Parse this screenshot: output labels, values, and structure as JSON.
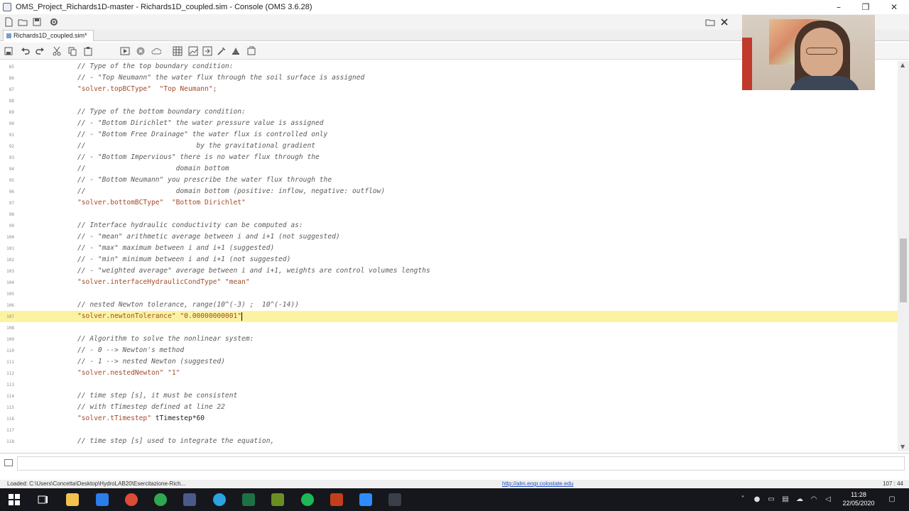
{
  "window": {
    "title": "OMS_Project_Richards1D-master - Richards1D_coupled.sim - Console (OMS 3.6.28)",
    "minimize_glyph": "–",
    "restore_glyph": "❐",
    "close_glyph": "✕"
  },
  "tab": {
    "label": "Richards1D_coupled.sim*"
  },
  "editor": {
    "lines": [
      {
        "n": "85",
        "kind": "cm",
        "text": "// Type of the top boundary condition:"
      },
      {
        "n": "86",
        "kind": "cm",
        "text": "// - \"Top Neumann\" the water flux through the soil surface is assigned"
      },
      {
        "n": "87",
        "kind": "str",
        "text": "\"solver.topBCType\"  \"Top Neumann\";"
      },
      {
        "n": "88",
        "kind": "plain",
        "text": ""
      },
      {
        "n": "89",
        "kind": "cm",
        "text": "// Type of the bottom boundary condition:"
      },
      {
        "n": "90",
        "kind": "cm",
        "text": "// - \"Bottom Dirichlet\" the water pressure value is assigned"
      },
      {
        "n": "91",
        "kind": "cm",
        "text": "// - \"Bottom Free Drainage\" the water flux is controlled only"
      },
      {
        "n": "92",
        "kind": "cm",
        "text": "//                           by the gravitational gradient"
      },
      {
        "n": "93",
        "kind": "cm",
        "text": "// - \"Bottom Impervious\" there is no water flux through the"
      },
      {
        "n": "94",
        "kind": "cm",
        "text": "//                      domain bottom"
      },
      {
        "n": "95",
        "kind": "cm",
        "text": "// - \"Bottom Neumann\" you prescribe the water flux through the"
      },
      {
        "n": "96",
        "kind": "cm",
        "text": "//                      domain bottom (positive: inflow, negative: outflow)"
      },
      {
        "n": "97",
        "kind": "str",
        "text": "\"solver.bottomBCType\"  \"Bottom Dirichlet\""
      },
      {
        "n": "98",
        "kind": "plain",
        "text": ""
      },
      {
        "n": "99",
        "kind": "cm",
        "text": "// Interface hydraulic conductivity can be computed as:"
      },
      {
        "n": "100",
        "kind": "cm",
        "text": "// - \"mean\" arithmetic average between i and i+1 (not suggested)"
      },
      {
        "n": "101",
        "kind": "cm",
        "text": "// - \"max\" maximum between i and i+1 (suggested)"
      },
      {
        "n": "102",
        "kind": "cm",
        "text": "// - \"min\" minimum between i and i+1 (not suggested)"
      },
      {
        "n": "103",
        "kind": "cm",
        "text": "// - \"weighted average\" average between i and i+1, weights are control volumes lengths"
      },
      {
        "n": "104",
        "kind": "str",
        "text": "\"solver.interfaceHydraulicCondType\" \"mean\""
      },
      {
        "n": "105",
        "kind": "plain",
        "text": ""
      },
      {
        "n": "106",
        "kind": "cm",
        "text": "// nested Newton tolerance, range(10^(-3) ;  10^(-14))"
      },
      {
        "n": "107",
        "kind": "str",
        "text": "\"solver.newtonTolerance\" \"0.00000000001\"",
        "current": true
      },
      {
        "n": "108",
        "kind": "plain",
        "text": ""
      },
      {
        "n": "109",
        "kind": "cm",
        "text": "// Algorithm to solve the nonlinear system:"
      },
      {
        "n": "110",
        "kind": "cm",
        "text": "// - 0 --> Newton's method"
      },
      {
        "n": "111",
        "kind": "cm",
        "text": "// - 1 --> nested Newton (suggested)"
      },
      {
        "n": "112",
        "kind": "str",
        "text": "\"solver.nestedNewton\" \"1\""
      },
      {
        "n": "113",
        "kind": "plain",
        "text": ""
      },
      {
        "n": "114",
        "kind": "cm",
        "text": "// time step [s], it must be consistent"
      },
      {
        "n": "115",
        "kind": "cm",
        "text": "// with tTimestep defined at line 22"
      },
      {
        "n": "116",
        "kind": "mix",
        "text": "\"solver.tTimestep\"",
        "rest": " tTimestep*60"
      },
      {
        "n": "117",
        "kind": "plain",
        "text": ""
      },
      {
        "n": "118",
        "kind": "cm",
        "text": "// time step [s] used to integrate the equation,"
      }
    ]
  },
  "statusbar": {
    "loaded": "Loaded: C:\\Users\\Concetta\\Desktop\\HydroLAB20\\Esercitazione-Rich...",
    "link": "http://alm.engr.colostate.edu",
    "position": "107 : 44"
  },
  "taskbar": {
    "time": "11:28",
    "date": "22/05/2020"
  },
  "colors": {
    "current_line": "#fbf3a2",
    "string": "#a34a2a",
    "comment": "#5b5b5b",
    "taskbar": "#15171c"
  }
}
